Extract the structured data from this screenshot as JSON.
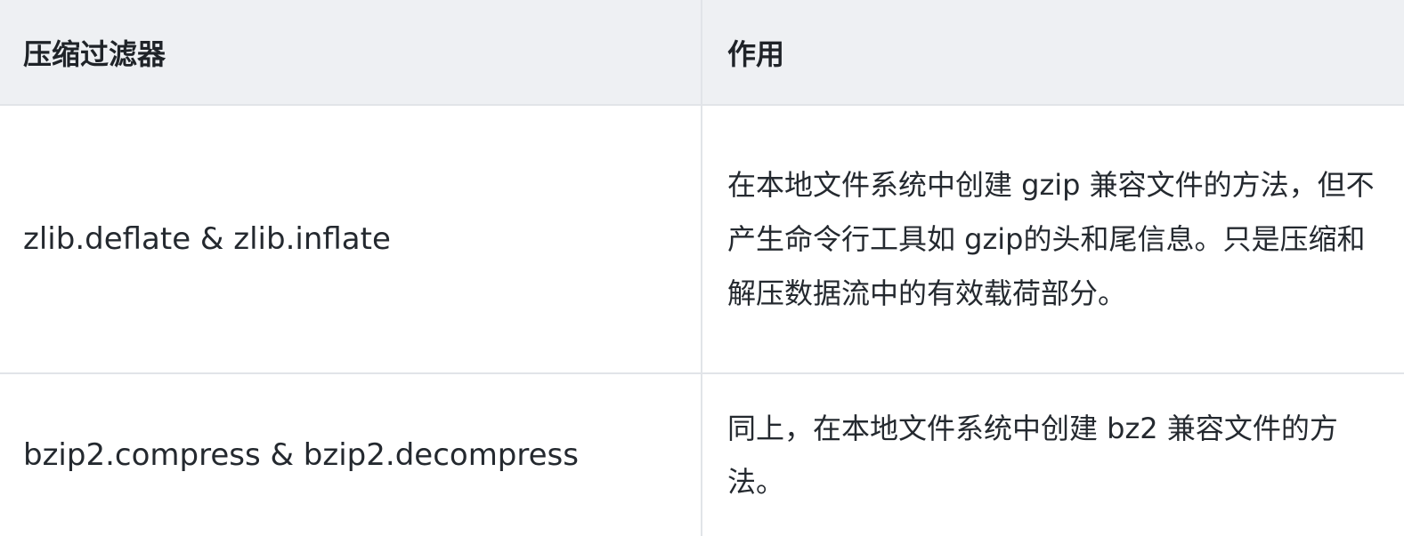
{
  "table": {
    "headers": [
      "压缩过滤器",
      "作用"
    ],
    "rows": [
      {
        "filter": "zlib.deflate & zlib.inflate",
        "purpose": "在本地文件系统中创建 gzip 兼容文件的方法，但不产生命令行工具如 gzip的头和尾信息。只是压缩和解压数据流中的有效载荷部分。"
      },
      {
        "filter": "bzip2.compress & bzip2.decompress",
        "purpose": "同上，在本地文件系统中创建 bz2 兼容文件的方法。"
      }
    ]
  }
}
